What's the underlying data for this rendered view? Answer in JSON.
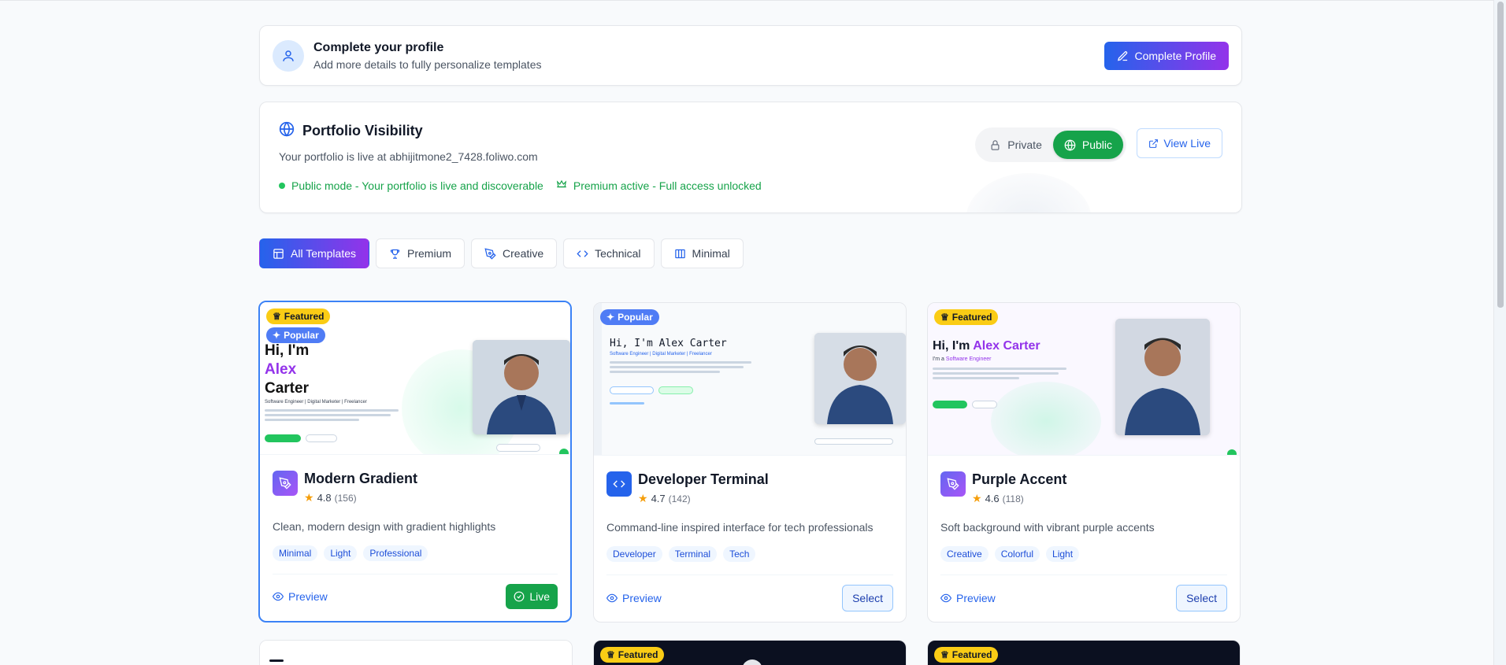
{
  "profile": {
    "title": "Complete your profile",
    "subtitle": "Add more details to fully personalize templates",
    "button": "Complete Profile"
  },
  "visibility": {
    "title": "Portfolio Visibility",
    "url_text": "Your portfolio is live at abhijitmone2_7428.foliwo.com",
    "status_public": "Public mode - Your portfolio is live and discoverable",
    "status_premium": "Premium active - Full access unlocked",
    "toggle_private": "Private",
    "toggle_public": "Public",
    "view_live": "View Live"
  },
  "filters": [
    {
      "label": "All Templates",
      "icon": "layout-icon"
    },
    {
      "label": "Premium",
      "icon": "trophy-icon"
    },
    {
      "label": "Creative",
      "icon": "pen-tool-icon"
    },
    {
      "label": "Technical",
      "icon": "code-icon"
    },
    {
      "label": "Minimal",
      "icon": "columns-icon"
    }
  ],
  "templates": [
    {
      "name": "Modern Gradient",
      "rating": "4.8",
      "count": "(156)",
      "description": "Clean, modern design with gradient highlights",
      "tags": [
        "Minimal",
        "Light",
        "Professional"
      ],
      "badges": [
        "Featured",
        "Popular"
      ],
      "preview": "Preview",
      "action": "Live",
      "mock": {
        "hi": "Hi, I'm",
        "first": "Alex",
        "last": "Carter",
        "role": "Software Engineer | Digital Marketer | Freelancer"
      }
    },
    {
      "name": "Developer Terminal",
      "rating": "4.7",
      "count": "(142)",
      "description": "Command-line inspired interface for tech professionals",
      "tags": [
        "Developer",
        "Terminal",
        "Tech"
      ],
      "badges": [
        "Popular"
      ],
      "preview": "Preview",
      "action": "Select",
      "mock": {
        "hi": "Hi, I'm Alex Carter",
        "role": "Software Engineer | Digital Marketer | Freelancer"
      }
    },
    {
      "name": "Purple Accent",
      "rating": "4.6",
      "count": "(118)",
      "description": "Soft background with vibrant purple accents",
      "tags": [
        "Creative",
        "Colorful",
        "Light"
      ],
      "badges": [
        "Featured"
      ],
      "preview": "Preview",
      "action": "Select",
      "mock": {
        "hi": "Hi, I'm",
        "name": "Alex Carter",
        "role_prefix": "I'm a",
        "role": "Software Engineer"
      }
    }
  ],
  "second_row_badges": [
    "Featured",
    "Featured"
  ],
  "colors": {
    "brand_gradient_start": "#2563eb",
    "brand_gradient_end": "#9333ea",
    "public_green": "#16a34a",
    "featured_yellow": "#facc15",
    "popular_blue": "#4f7cf5"
  }
}
